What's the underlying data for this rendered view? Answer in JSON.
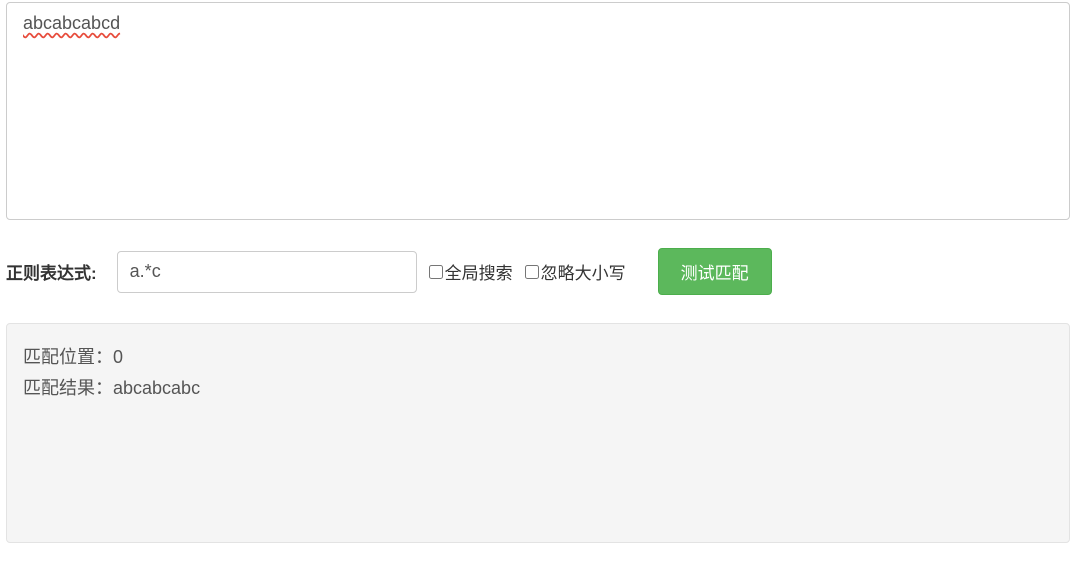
{
  "test_string": {
    "value": "abcabcabcd"
  },
  "controls": {
    "regex_label": "正则表达式:",
    "regex_value": "a.*c",
    "global_search_label": "全局搜索",
    "ignore_case_label": "忽略大小写",
    "test_button_label": "测试匹配"
  },
  "result": {
    "position_label": "匹配位置：",
    "position_value": "0",
    "match_label": "匹配结果：",
    "match_value": "abcabcabc"
  }
}
